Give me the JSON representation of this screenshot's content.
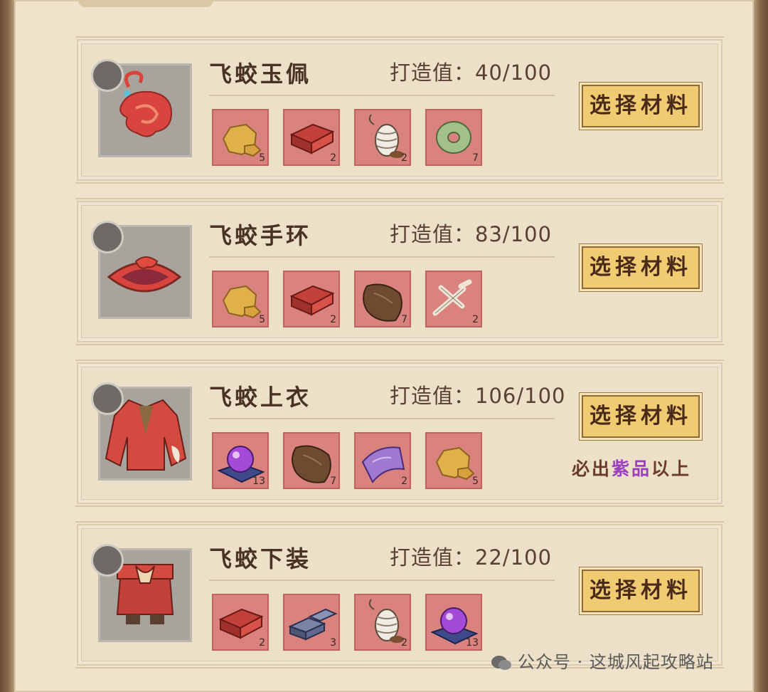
{
  "forge_label": "打造值：",
  "select_label": "选择材料",
  "items": [
    {
      "name": "飞蛟玉佩",
      "forge_value": "40/100",
      "materials": [
        {
          "icon": "gold-ore-icon",
          "qty": "5"
        },
        {
          "icon": "red-brick-icon",
          "qty": "2"
        },
        {
          "icon": "thread-spool-icon",
          "qty": "2"
        },
        {
          "icon": "jade-disc-icon",
          "qty": "7"
        }
      ]
    },
    {
      "name": "飞蛟手环",
      "forge_value": "83/100",
      "materials": [
        {
          "icon": "gold-ore-icon",
          "qty": "5"
        },
        {
          "icon": "red-brick-icon",
          "qty": "2"
        },
        {
          "icon": "fur-pelt-icon",
          "qty": "7"
        },
        {
          "icon": "bone-icon",
          "qty": "2"
        }
      ]
    },
    {
      "name": "飞蛟上衣",
      "forge_value": "106/100",
      "materials": [
        {
          "icon": "purple-orb-icon",
          "qty": "13"
        },
        {
          "icon": "fur-pelt-icon",
          "qty": "7"
        },
        {
          "icon": "purple-cloth-icon",
          "qty": "2"
        },
        {
          "icon": "gold-ore-icon",
          "qty": "5"
        }
      ],
      "note": {
        "prefix": "必出",
        "highlight": "紫品",
        "suffix": "以上"
      }
    },
    {
      "name": "飞蛟下装",
      "forge_value": "22/100",
      "materials": [
        {
          "icon": "red-brick-icon",
          "qty": "2"
        },
        {
          "icon": "iron-ingot-icon",
          "qty": "3"
        },
        {
          "icon": "thread-spool-icon",
          "qty": "2"
        },
        {
          "icon": "purple-orb-icon",
          "qty": "13"
        }
      ]
    }
  ],
  "watermark": "公众号 · 这城风起攻略站",
  "colors": {
    "accent_purple": "#9b3fc0",
    "button_gold": "#f0cb72",
    "slot_red": "#d9827e"
  }
}
